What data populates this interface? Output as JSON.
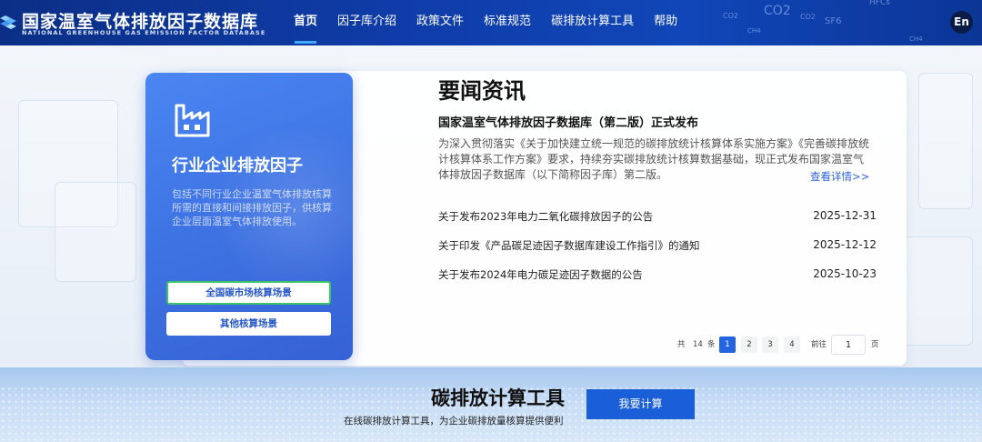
{
  "header": {
    "logo_cn": "国家温室气体排放因子数据库",
    "logo_en": "NATIONAL GREENHOUSE GAS EMISSION FACTOR DATABASE",
    "nav": [
      "首页",
      "因子库介绍",
      "政策文件",
      "标准规范",
      "碳排放计算工具",
      "帮助"
    ],
    "active_nav": "首页",
    "lang_button": "En",
    "gas_labels": [
      "HFCs",
      "CO2",
      "CO2",
      "CO2",
      "SF6",
      "CH4",
      "CH4"
    ]
  },
  "card": {
    "title": "行业企业排放因子",
    "description": "包括不同行业企业温室气体排放核算所需的直接和间接排放因子，供核算企业层面温室气体排放使用。",
    "button_primary": "全国碳市场核算场景",
    "button_secondary": "其他核算场景"
  },
  "news": {
    "heading": "要闻资讯",
    "lead_title": "国家温室气体排放因子数据库（第二版）正式发布",
    "lead_body": "为深入贯彻落实《关于加快建立统一规范的碳排放统计核算体系实施方案》《完善碳排放统计核算体系工作方案》要求，持续夯实碳排放统计核算数据基础，现正式发布国家温室气体排放因子数据库（以下简称因子库）第二版。",
    "more_link": "查看详情>>",
    "items": [
      {
        "title": "关于发布2023年电力二氧化碳排放因子的公告",
        "date": "2025-12-31"
      },
      {
        "title": "关于印发《产品碳足迹因子数据库建设工作指引》的通知",
        "date": "2025-12-12"
      },
      {
        "title": "关于发布2024年电力碳足迹因子数据的公告",
        "date": "2025-10-23"
      }
    ]
  },
  "pagination": {
    "total_prefix": "共",
    "total": "14",
    "total_suffix": "条",
    "pages": [
      "1",
      "2",
      "3",
      "4"
    ],
    "current": "1",
    "goto_label": "前往",
    "goto_value": "1",
    "page_suffix": "页"
  },
  "tool_band": {
    "title": "碳排放计算工具",
    "subtitle": "在线碳排放计算工具，为企业碳排放量核算提供便利",
    "button": "我要计算"
  },
  "colors": {
    "header_bg": "#0f3ca8",
    "card_bg": "#3f74e4",
    "accent": "#2364e0",
    "primary_btn_border": "#3cc46b",
    "band_bg": "#c6dcf5"
  },
  "icons": {
    "logo": "cubes-logo-icon",
    "card": "factory-icon"
  }
}
